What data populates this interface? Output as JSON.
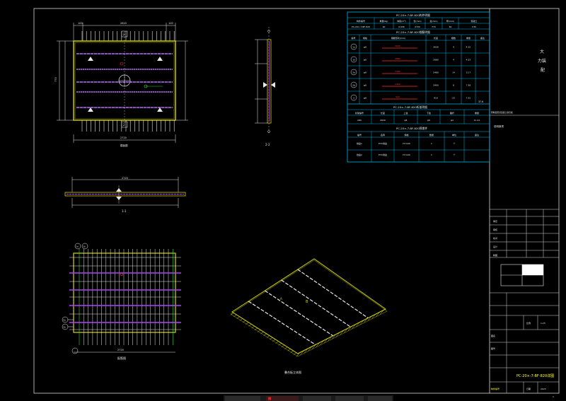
{
  "colors": {
    "frame": "#e8e8e8",
    "dim": "#e8e8e8",
    "slab_edge": "#d4d400",
    "rebar": "#e0e0ff",
    "rebar_magenta": "#b040ff",
    "table": "#00b4e6",
    "table_text": "#e0f0ff",
    "red": "#ff3030",
    "green": "#40ff40",
    "yellow": "#ffff40",
    "orange": "#ff9000"
  },
  "top_table": {
    "title1": "PC-20×-7-BF-820构件明细",
    "head1": [
      "构件编号",
      "重量(kg)",
      "体积(m³)",
      "长(mm)",
      "宽(mm)",
      "厚(mm)",
      "混凝土"
    ],
    "row1": [
      "PC-20×-7-BF-820",
      "90",
      "0.036",
      "2720",
      "770",
      "60",
      "C30"
    ],
    "title2": "PC-20×-7-BF-820钢筋明细",
    "head2": [
      "编号",
      "规格",
      "钢筋形状(mm)",
      "长度",
      "根数",
      "重量",
      "备注"
    ],
    "rebar_rows": [
      {
        "id": "1a",
        "spec": "φ8",
        "shape": "2630",
        "len": "2630",
        "n": "4",
        "w": "4.15"
      },
      {
        "id": "1b",
        "spec": "φ8",
        "shape": "2680",
        "len": "2680",
        "n": "4",
        "w": "4.23"
      },
      {
        "id": "2a",
        "spec": "φ8",
        "shape": "2480",
        "len": "2480",
        "n": "14",
        "w": "13.7"
      },
      {
        "id": "2b",
        "spec": "φ8",
        "shape": "2400",
        "len": "2400",
        "n": "8",
        "w": "7.58"
      },
      {
        "id": "3",
        "spec": "φ8",
        "shape": "910",
        "len": "910",
        "n": "22",
        "w": "7.91"
      }
    ],
    "total": "37.6",
    "title3": "PC-20×-7-BF-820桁架明细",
    "head3": [
      "桁架编号",
      "长度",
      "上弦",
      "下弦",
      "腹杆",
      "重量"
    ],
    "row3": [
      "A80",
      "2620",
      "φ8",
      "φ6",
      "φ4",
      "11.41"
    ],
    "title4": "PC-20×-7-BF-820预埋件",
    "head4": [
      "编号",
      "名称",
      "规格",
      "数量",
      "单位",
      "备注"
    ],
    "embed_rows": [
      [
        "线盒1",
        "PVC线盒",
        "H=100",
        "1",
        "个",
        ""
      ],
      [
        "线盒2",
        "PVC线盒",
        "H=100",
        "1",
        "个",
        ""
      ]
    ]
  },
  "title_block": {
    "project_name": "大力装配",
    "note_line": "预制装配式混凝土叠合板",
    "design_note": "说明事项",
    "rows": [
      "审定",
      "审核",
      "校对",
      "设计",
      "制图"
    ],
    "scale_label": "比例",
    "scale_value": "1:25",
    "drawing_no": "PC-20×-7-BF-820详图",
    "date_label": "日期",
    "date_value": "2023",
    "drawing_label": "图号",
    "sheet_label": "图名",
    "bottom_label": "构件编号",
    "page_no": "1"
  },
  "views": {
    "plan": "模板图",
    "elev": "1-1",
    "side": "2-2",
    "rebar_plan": "配筋图",
    "iso": "叠合板立体图"
  },
  "dims": {
    "top_a": "100",
    "top_mid": "2620",
    "top_b": "100",
    "total_w": "2720",
    "total_w2": "2720",
    "side_h": "770",
    "rebar_w": "2720"
  },
  "markers": {
    "label1": "1",
    "label2": "2",
    "callout1": "1a",
    "callout2": "1b",
    "callout3": "2a",
    "callout4": "2b",
    "iso_A": "A",
    "iso_B": "B"
  },
  "taskbar": {
    "items": [
      "",
      "",
      "",
      "",
      "",
      "",
      "",
      "",
      ""
    ]
  }
}
